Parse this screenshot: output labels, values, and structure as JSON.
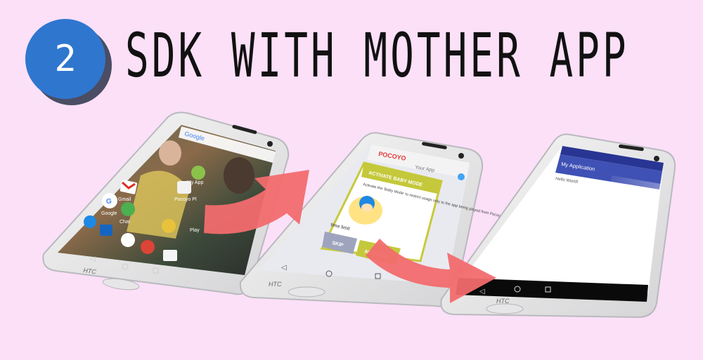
{
  "step_number": "2",
  "title": "SDK WITH MOTHER APP",
  "colors": {
    "background": "#fbe0f8",
    "badge": "#2f76cf",
    "badge_shadow": "#4a4d63",
    "arrow": "#f26b6e",
    "app_bar": "#3f51b5"
  },
  "phone1": {
    "brand": "HTC",
    "search_logo": "Google",
    "apps": [
      {
        "label": "Gmail",
        "icon": "gmail-icon"
      },
      {
        "label": "My App",
        "icon": "android-icon"
      },
      {
        "label": "Google",
        "icon": "google-icon"
      },
      {
        "label": "Chat",
        "icon": "chat-icon"
      },
      {
        "label": "Pocoyo Pl",
        "icon": "pocoyo-icon"
      },
      {
        "label": "Play",
        "icon": "play-icon"
      }
    ]
  },
  "phone2": {
    "brand": "HTC",
    "logo": "POCOYO",
    "header_text": "Your App",
    "dialog_title": "ACTIVATE BABY MODE",
    "dialog_body": "Activate the 'Baby Mode' to restrict usage only to the app being played from Pocoyo House",
    "time_limit_label": "time limit",
    "skip_button": "SKIP",
    "activate_button": "ACTIVATE"
  },
  "phone3": {
    "brand": "HTC",
    "app_bar_title": "My Application",
    "body_text": "Hello World!"
  }
}
